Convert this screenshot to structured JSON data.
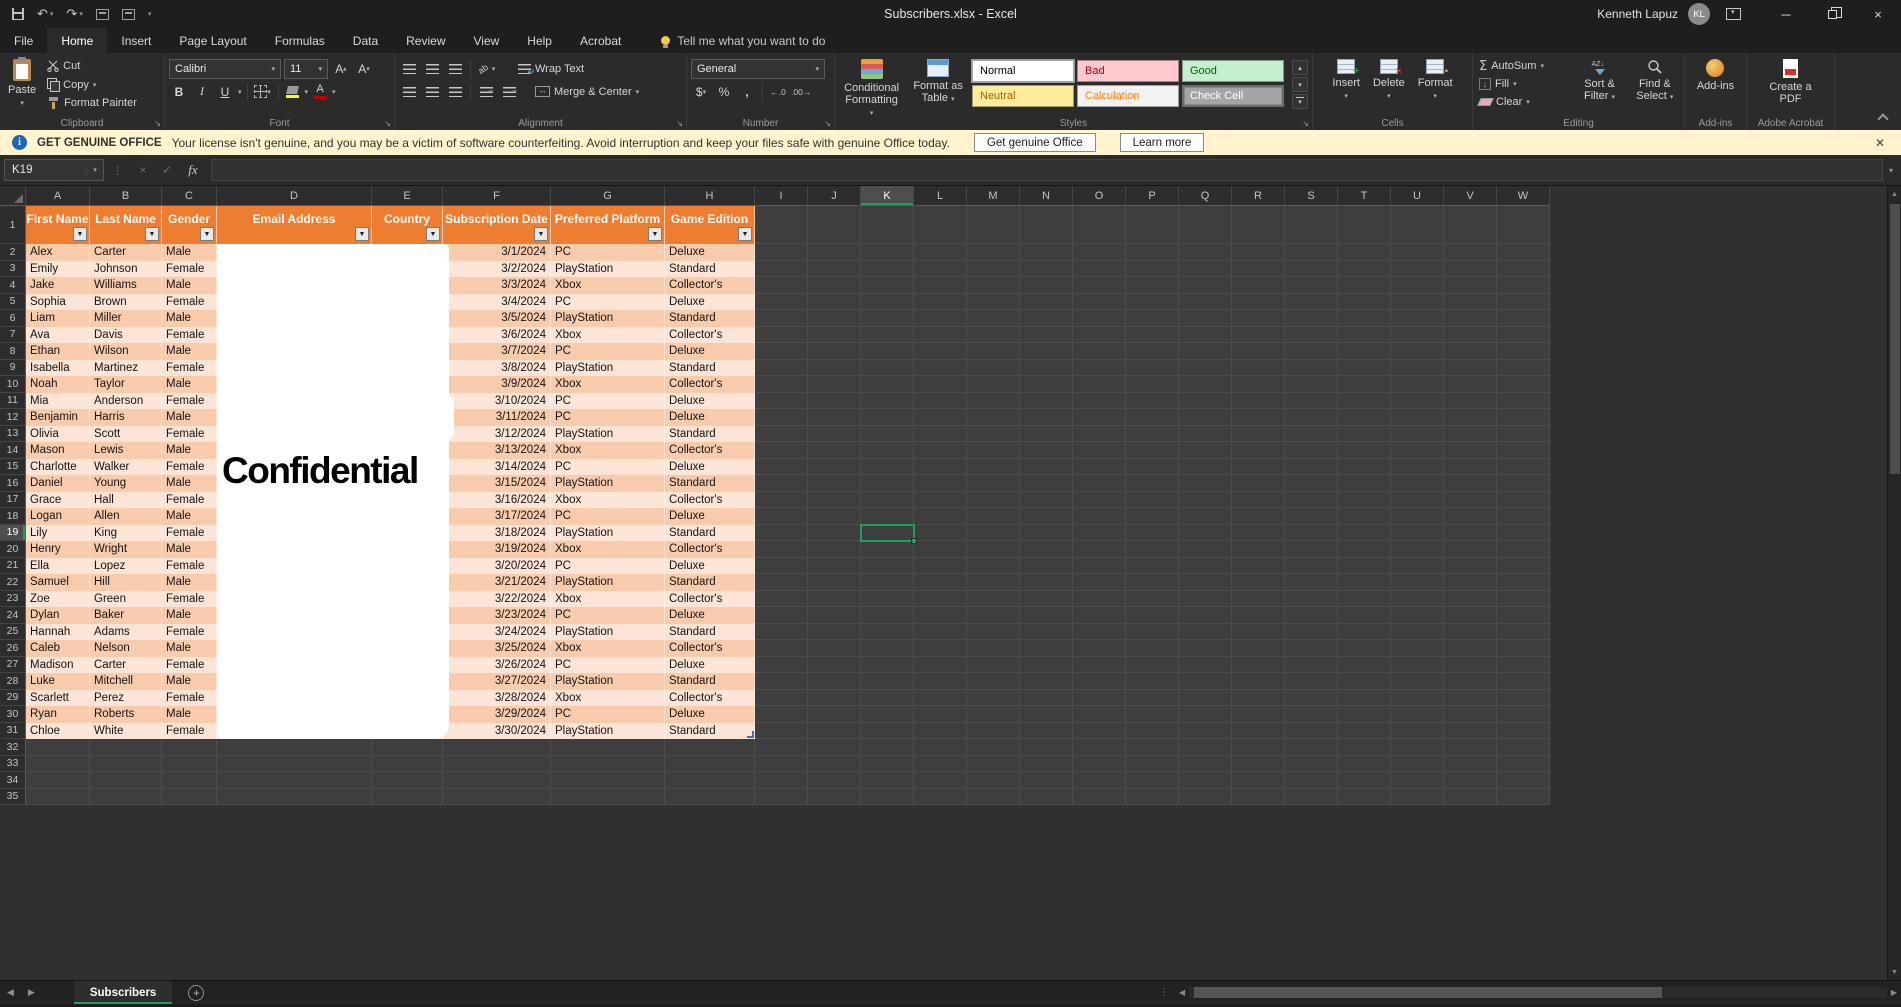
{
  "titlebar": {
    "title": "Subscribers.xlsx  -  Excel",
    "user": {
      "name": "Kenneth Lapuz",
      "initials": "KL"
    }
  },
  "tabs": {
    "items": [
      "File",
      "Home",
      "Insert",
      "Page Layout",
      "Formulas",
      "Data",
      "Review",
      "View",
      "Help",
      "Acrobat"
    ],
    "active": "Home",
    "tell_me": "Tell me what you want to do"
  },
  "ribbon": {
    "clipboard": {
      "label": "Clipboard",
      "paste": "Paste",
      "cut": "Cut",
      "copy": "Copy",
      "format_painter": "Format Painter"
    },
    "font": {
      "label": "Font",
      "name": "Calibri",
      "size": "11",
      "bold": "B",
      "italic": "I",
      "underline": "U",
      "size_up": "A",
      "size_down": "A",
      "color_letter": "A"
    },
    "alignment": {
      "label": "Alignment",
      "wrap": "Wrap Text",
      "merge": "Merge & Center"
    },
    "number": {
      "label": "Number",
      "format": "General",
      "currency": "$",
      "percent": "%",
      "comma": ",",
      "inc_decimal": "←.0",
      "dec_decimal": ".00→"
    },
    "styles": {
      "label": "Styles",
      "conditional": "Conditional Formatting",
      "format_table": "Format as Table",
      "gallery": [
        {
          "name": "Normal",
          "bg": "#FFFFFF",
          "fg": "#000000"
        },
        {
          "name": "Bad",
          "bg": "#FFC7CE",
          "fg": "#9C0006"
        },
        {
          "name": "Good",
          "bg": "#C6EFCE",
          "fg": "#006100"
        },
        {
          "name": "Neutral",
          "bg": "#FFEB9C",
          "fg": "#9C6500"
        },
        {
          "name": "Calculation",
          "bg": "#F2F2F2",
          "fg": "#FA7D00"
        },
        {
          "name": "Check Cell",
          "bg": "#A5A5A5",
          "fg": "#FFFFFF"
        }
      ]
    },
    "cells": {
      "label": "Cells",
      "insert": "Insert",
      "delete": "Delete",
      "format": "Format"
    },
    "editing": {
      "label": "Editing",
      "autosum": "AutoSum",
      "fill": "Fill",
      "clear": "Clear",
      "sort": "Sort & Filter",
      "find": "Find & Select"
    },
    "addins": {
      "label": "Add-ins",
      "button": "Add-ins"
    },
    "acrobat": {
      "label": "Adobe Acrobat",
      "button": "Create a PDF"
    }
  },
  "notice": {
    "badge": "GET GENUINE OFFICE",
    "message": "Your license isn't genuine, and you may be a victim of software counterfeiting. Avoid interruption and keep your files safe with genuine Office today.",
    "button_primary": "Get genuine Office",
    "button_secondary": "Learn more"
  },
  "formula_bar": {
    "name_box": "K19",
    "fx": "fx",
    "formula": ""
  },
  "sheet": {
    "column_letters": [
      "A",
      "B",
      "C",
      "D",
      "E",
      "F",
      "G",
      "H",
      "I",
      "J",
      "K",
      "L",
      "M",
      "N",
      "O",
      "P",
      "Q",
      "R",
      "S",
      "T",
      "U",
      "V",
      "W"
    ],
    "rows_total": 35,
    "selection": {
      "ref": "K19",
      "column": "K",
      "row": 19
    },
    "watermark": "Confidential",
    "table": {
      "headers": [
        "First Name",
        "Last Name",
        "Gender",
        "Email Address",
        "Country",
        "Subscription Date",
        "Preferred Platform",
        "Game Edition"
      ],
      "rows": [
        [
          "Alex",
          "Carter",
          "Male",
          "3/1/2024",
          "PC",
          "Deluxe"
        ],
        [
          "Emily",
          "Johnson",
          "Female",
          "3/2/2024",
          "PlayStation",
          "Standard"
        ],
        [
          "Jake",
          "Williams",
          "Male",
          "3/3/2024",
          "Xbox",
          "Collector's"
        ],
        [
          "Sophia",
          "Brown",
          "Female",
          "3/4/2024",
          "PC",
          "Deluxe"
        ],
        [
          "Liam",
          "Miller",
          "Male",
          "3/5/2024",
          "PlayStation",
          "Standard"
        ],
        [
          "Ava",
          "Davis",
          "Female",
          "3/6/2024",
          "Xbox",
          "Collector's"
        ],
        [
          "Ethan",
          "Wilson",
          "Male",
          "3/7/2024",
          "PC",
          "Deluxe"
        ],
        [
          "Isabella",
          "Martinez",
          "Female",
          "3/8/2024",
          "PlayStation",
          "Standard"
        ],
        [
          "Noah",
          "Taylor",
          "Male",
          "3/9/2024",
          "Xbox",
          "Collector's"
        ],
        [
          "Mia",
          "Anderson",
          "Female",
          "3/10/2024",
          "PC",
          "Deluxe"
        ],
        [
          "Benjamin",
          "Harris",
          "Male",
          "3/11/2024",
          "PC",
          "Deluxe"
        ],
        [
          "Olivia",
          "Scott",
          "Female",
          "3/12/2024",
          "PlayStation",
          "Standard"
        ],
        [
          "Mason",
          "Lewis",
          "Male",
          "3/13/2024",
          "Xbox",
          "Collector's"
        ],
        [
          "Charlotte",
          "Walker",
          "Female",
          "3/14/2024",
          "PC",
          "Deluxe"
        ],
        [
          "Daniel",
          "Young",
          "Male",
          "3/15/2024",
          "PlayStation",
          "Standard"
        ],
        [
          "Grace",
          "Hall",
          "Female",
          "3/16/2024",
          "Xbox",
          "Collector's"
        ],
        [
          "Logan",
          "Allen",
          "Male",
          "3/17/2024",
          "PC",
          "Deluxe"
        ],
        [
          "Lily",
          "King",
          "Female",
          "3/18/2024",
          "PlayStation",
          "Standard"
        ],
        [
          "Henry",
          "Wright",
          "Male",
          "3/19/2024",
          "Xbox",
          "Collector's"
        ],
        [
          "Ella",
          "Lopez",
          "Female",
          "3/20/2024",
          "PC",
          "Deluxe"
        ],
        [
          "Samuel",
          "Hill",
          "Male",
          "3/21/2024",
          "PlayStation",
          "Standard"
        ],
        [
          "Zoe",
          "Green",
          "Female",
          "3/22/2024",
          "Xbox",
          "Collector's"
        ],
        [
          "Dylan",
          "Baker",
          "Male",
          "3/23/2024",
          "PC",
          "Deluxe"
        ],
        [
          "Hannah",
          "Adams",
          "Female",
          "3/24/2024",
          "PlayStation",
          "Standard"
        ],
        [
          "Caleb",
          "Nelson",
          "Male",
          "3/25/2024",
          "Xbox",
          "Collector's"
        ],
        [
          "Madison",
          "Carter",
          "Female",
          "3/26/2024",
          "PC",
          "Deluxe"
        ],
        [
          "Luke",
          "Mitchell",
          "Male",
          "3/27/2024",
          "PlayStation",
          "Standard"
        ],
        [
          "Scarlett",
          "Perez",
          "Female",
          "3/28/2024",
          "Xbox",
          "Collector's"
        ],
        [
          "Ryan",
          "Roberts",
          "Male",
          "3/29/2024",
          "PC",
          "Deluxe"
        ],
        [
          "Chloe",
          "White",
          "Female",
          "3/30/2024",
          "PlayStation",
          "Standard"
        ]
      ]
    }
  },
  "sheet_tabs": {
    "active": "Subscribers"
  },
  "colors": {
    "table_header": "#ED7D31",
    "band_a": "#F8CBAD",
    "band_b": "#FCE4D6",
    "selection_green": "#1FA15D",
    "notice_bg": "#FFF4CE"
  }
}
